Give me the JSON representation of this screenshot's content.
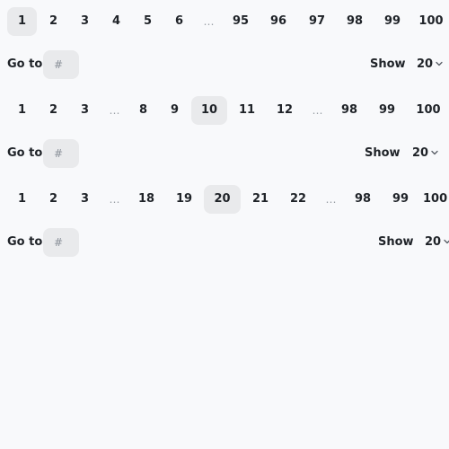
{
  "paginations": [
    {
      "pages": [
        {
          "label": "1",
          "active": true
        },
        {
          "label": "2",
          "active": false
        },
        {
          "label": "3",
          "active": false
        },
        {
          "label": "4",
          "active": false
        },
        {
          "label": "5",
          "active": false
        },
        {
          "label": "6",
          "active": false
        },
        {
          "label": "…",
          "ellipsis": true
        },
        {
          "label": "95",
          "active": false
        },
        {
          "label": "96",
          "active": false
        },
        {
          "label": "97",
          "active": false
        },
        {
          "label": "98",
          "active": false
        },
        {
          "label": "99",
          "active": false
        },
        {
          "label": "100",
          "active": false
        }
      ],
      "goto_label": "Go to",
      "goto_placeholder": "#",
      "show_label": "Show",
      "page_size": "20"
    },
    {
      "pages": [
        {
          "label": "1",
          "active": false
        },
        {
          "label": "2",
          "active": false
        },
        {
          "label": "3",
          "active": false
        },
        {
          "label": "…",
          "ellipsis": true
        },
        {
          "label": "8",
          "active": false
        },
        {
          "label": "9",
          "active": false
        },
        {
          "label": "10",
          "active": true
        },
        {
          "label": "11",
          "active": false
        },
        {
          "label": "12",
          "active": false
        },
        {
          "label": "…",
          "ellipsis": true
        },
        {
          "label": "98",
          "active": false
        },
        {
          "label": "99",
          "active": false
        },
        {
          "label": "100",
          "active": false
        }
      ],
      "goto_label": "Go to",
      "goto_placeholder": "#",
      "show_label": "Show",
      "page_size": "20"
    },
    {
      "pages": [
        {
          "label": "1",
          "active": false
        },
        {
          "label": "2",
          "active": false
        },
        {
          "label": "3",
          "active": false
        },
        {
          "label": "…",
          "ellipsis": true
        },
        {
          "label": "18",
          "active": false
        },
        {
          "label": "19",
          "active": false
        },
        {
          "label": "20",
          "active": true
        },
        {
          "label": "21",
          "active": false
        },
        {
          "label": "22",
          "active": false
        },
        {
          "label": "…",
          "ellipsis": true
        },
        {
          "label": "98",
          "active": false
        },
        {
          "label": "99",
          "active": false
        },
        {
          "label": "100",
          "active": false
        }
      ],
      "goto_label": "Go to",
      "goto_placeholder": "#",
      "show_label": "Show",
      "page_size": "20"
    }
  ],
  "colors": {
    "background": "#f8f9fb",
    "active_page_bg": "#e9eaec",
    "input_bg": "#e9eaec",
    "text": "#1f2328",
    "muted": "#9aa0a6"
  }
}
